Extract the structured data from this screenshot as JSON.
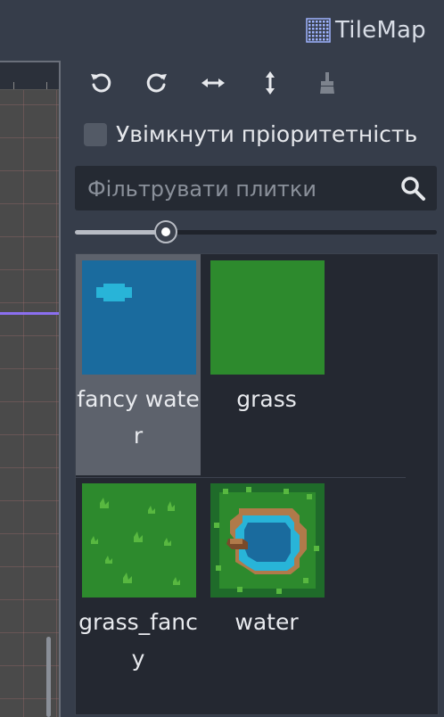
{
  "panel": {
    "title": "TileMap",
    "title_icon": "tilemap-grid-icon",
    "accent_color": "#9fb4ff"
  },
  "toolbar": {
    "tools": [
      {
        "name": "rotate-left",
        "icon": "rotate-left-icon"
      },
      {
        "name": "rotate-right",
        "icon": "rotate-right-icon"
      },
      {
        "name": "flip-horizontal",
        "icon": "flip-horizontal-icon"
      },
      {
        "name": "flip-vertical",
        "icon": "flip-vertical-icon"
      },
      {
        "name": "clear-transform",
        "icon": "eraser-broom-icon",
        "disabled": true
      }
    ]
  },
  "priority_toggle": {
    "label": "Увімкнути пріоритетність",
    "checked": false
  },
  "filter": {
    "placeholder": "Фільтрувати плитки",
    "value": ""
  },
  "zoom_slider": {
    "value_fraction": 0.25
  },
  "tiles": [
    {
      "label": "fancy water",
      "selected": true,
      "thumb": "fancy-water"
    },
    {
      "label": "grass",
      "selected": false,
      "thumb": "grass"
    },
    {
      "label": "grass_fancy",
      "selected": false,
      "thumb": "grass-fancy"
    },
    {
      "label": "water",
      "selected": false,
      "thumb": "water"
    }
  ],
  "colors": {
    "water": "#1a6b9e",
    "water_light": "#28b4d8",
    "grass": "#2d8a2d",
    "grass_light": "#58b840",
    "selection": "#5d626c",
    "guide_line": "#8b6ff0"
  }
}
